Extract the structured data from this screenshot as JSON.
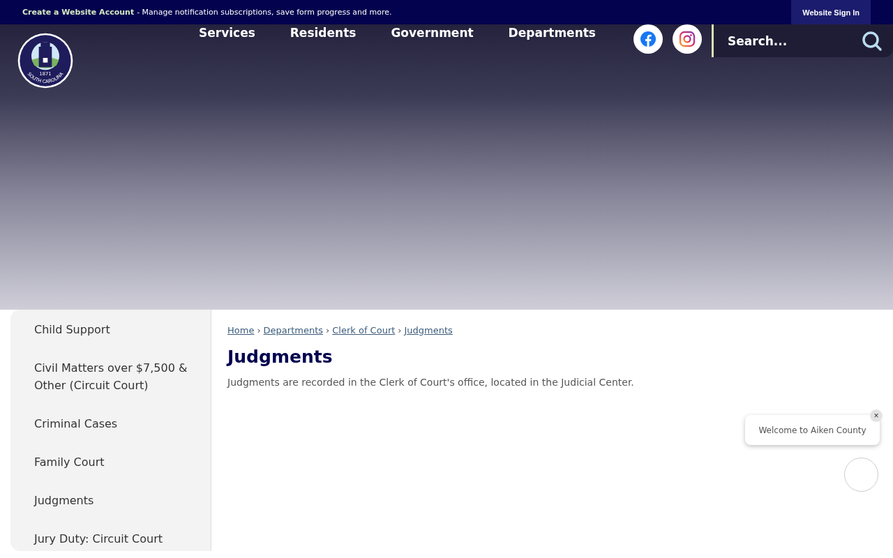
{
  "top_bar": {
    "account_link": "Create a Website Account",
    "message": "- Manage notification subscriptions, save form progress and more.",
    "sign_in": "Website Sign In"
  },
  "logo": {
    "year": "1871",
    "state": "SOUTH CAROLINA"
  },
  "nav": [
    "Services",
    "Residents",
    "Government",
    "Departments"
  ],
  "search": {
    "placeholder": "Search..."
  },
  "sidebar": {
    "items": [
      {
        "label": "Child Support",
        "selected": false
      },
      {
        "label": "Civil Matters over $7,500 & Other (Circuit Court)",
        "selected": false
      },
      {
        "label": "Criminal Cases",
        "selected": false
      },
      {
        "label": "Family Court",
        "selected": false
      },
      {
        "label": "Judgments",
        "selected": false
      },
      {
        "label": "Jury Duty: Circuit Court",
        "selected": false
      }
    ]
  },
  "breadcrumb": {
    "separator": "›",
    "items": [
      "Home",
      "Departments",
      "Clerk of Court",
      "Judgments"
    ]
  },
  "page": {
    "title": "Judgments",
    "body": "Judgments are recorded in the Clerk of Court's office, located in the Judicial Center."
  },
  "chat": {
    "greeting": "Welcome to Aiken County",
    "close": "×"
  }
}
